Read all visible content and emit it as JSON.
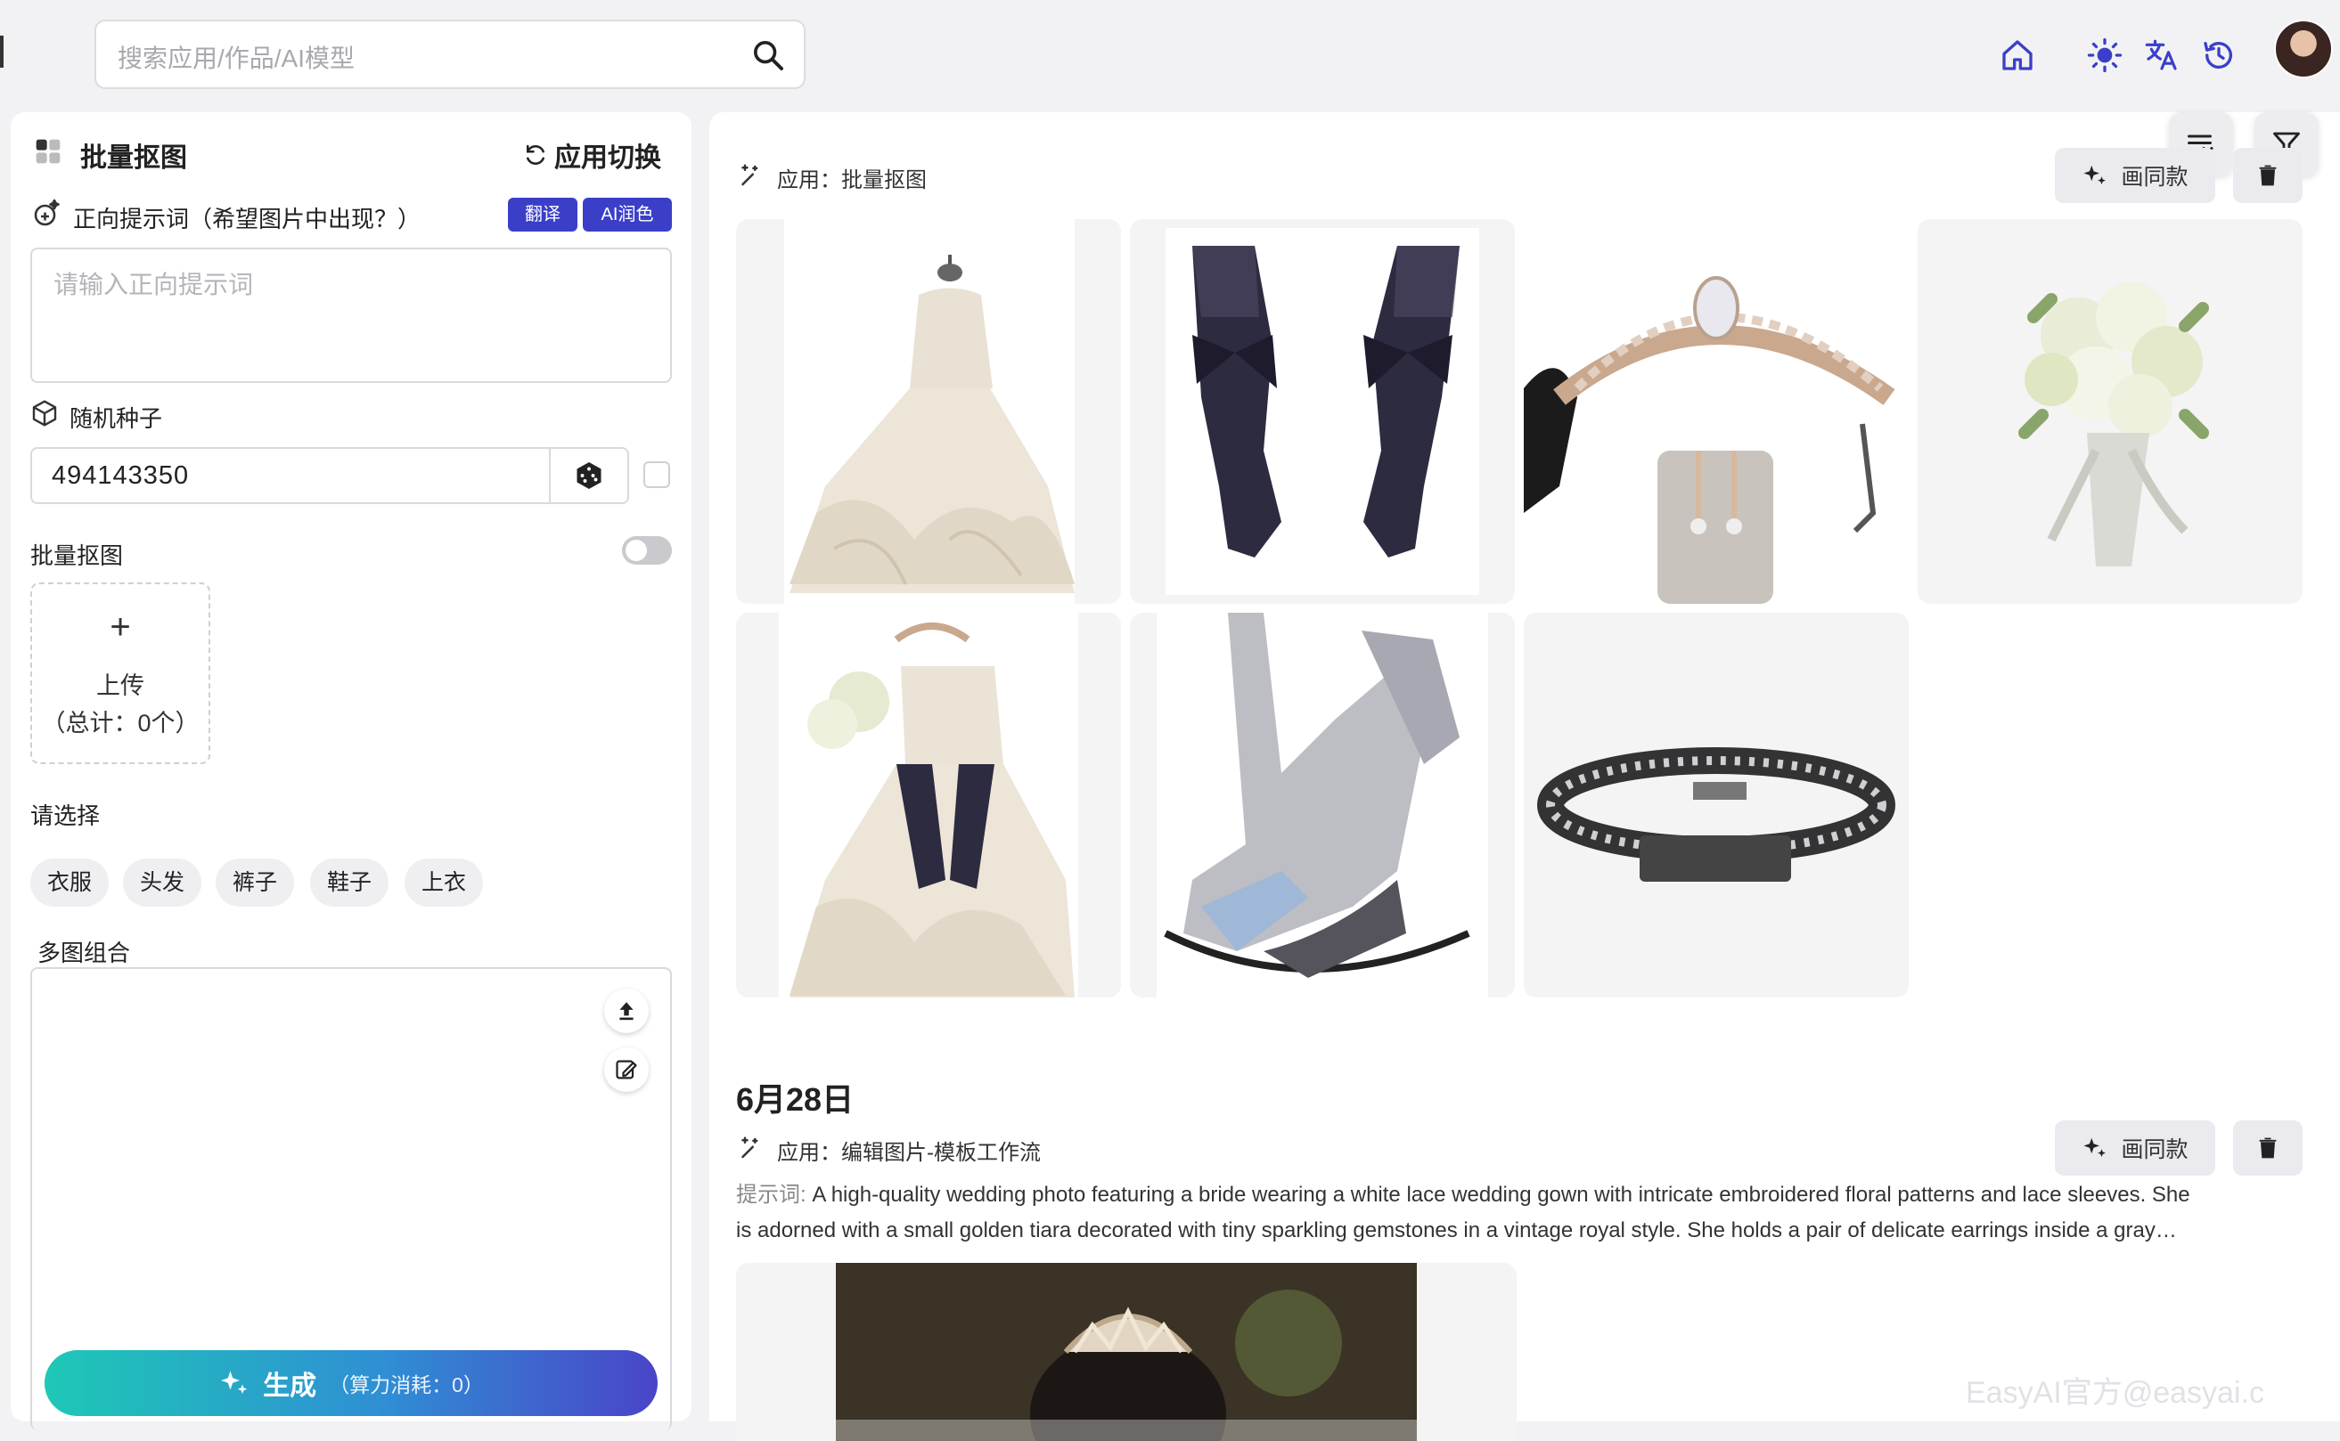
{
  "header": {
    "search_placeholder": "搜索应用/作品/AI模型",
    "icons": [
      "home-icon",
      "sun-icon",
      "translate-icon",
      "history-icon"
    ]
  },
  "left": {
    "app_title": "批量抠图",
    "switch_label": "应用切换",
    "prompt_label": "正向提示词（希望图片中出现？）",
    "translate_btn": "翻译",
    "polish_btn": "AI润色",
    "prompt_placeholder": "请输入正向提示词",
    "seed_label": "随机种子",
    "seed_value": "494143350",
    "batch_label": "批量抠图",
    "batch_toggle_on": false,
    "upload_plus": "+",
    "upload_label": "上传",
    "upload_count": "（总计：0个）",
    "select_label": "请选择",
    "chips": [
      "衣服",
      "头发",
      "裤子",
      "鞋子",
      "上衣"
    ],
    "multi_label": "多图组合",
    "generate_label": "生成",
    "generate_cost": "（算力消耗：0）"
  },
  "right": {
    "record1": {
      "app_prefix": "应用：",
      "app_name": "批量抠图",
      "same_btn": "画同款"
    },
    "record2": {
      "date": "6月28日",
      "app_prefix": "应用：",
      "app_name": "编辑图片-模板工作流",
      "same_btn": "画同款",
      "prompt_prefix": "提示词:",
      "prompt_line1": " A high-quality wedding photo featuring a bride wearing a white lace wedding gown with intricate embroidered floral patterns and lace sleeves. She",
      "prompt_line2": "is adorned with a small golden tiara decorated with tiny sparkling gemstones in a vintage royal style. She holds a pair of delicate earrings inside a gray…"
    },
    "watermark": "EasyAI官方@easyai.c"
  },
  "colors": {
    "accent": "#3b3fc8",
    "gradient_start": "#1ec8b6",
    "gradient_end": "#4a44c8",
    "panel_bg": "#ffffff",
    "page_bg": "#f2f2f4"
  }
}
